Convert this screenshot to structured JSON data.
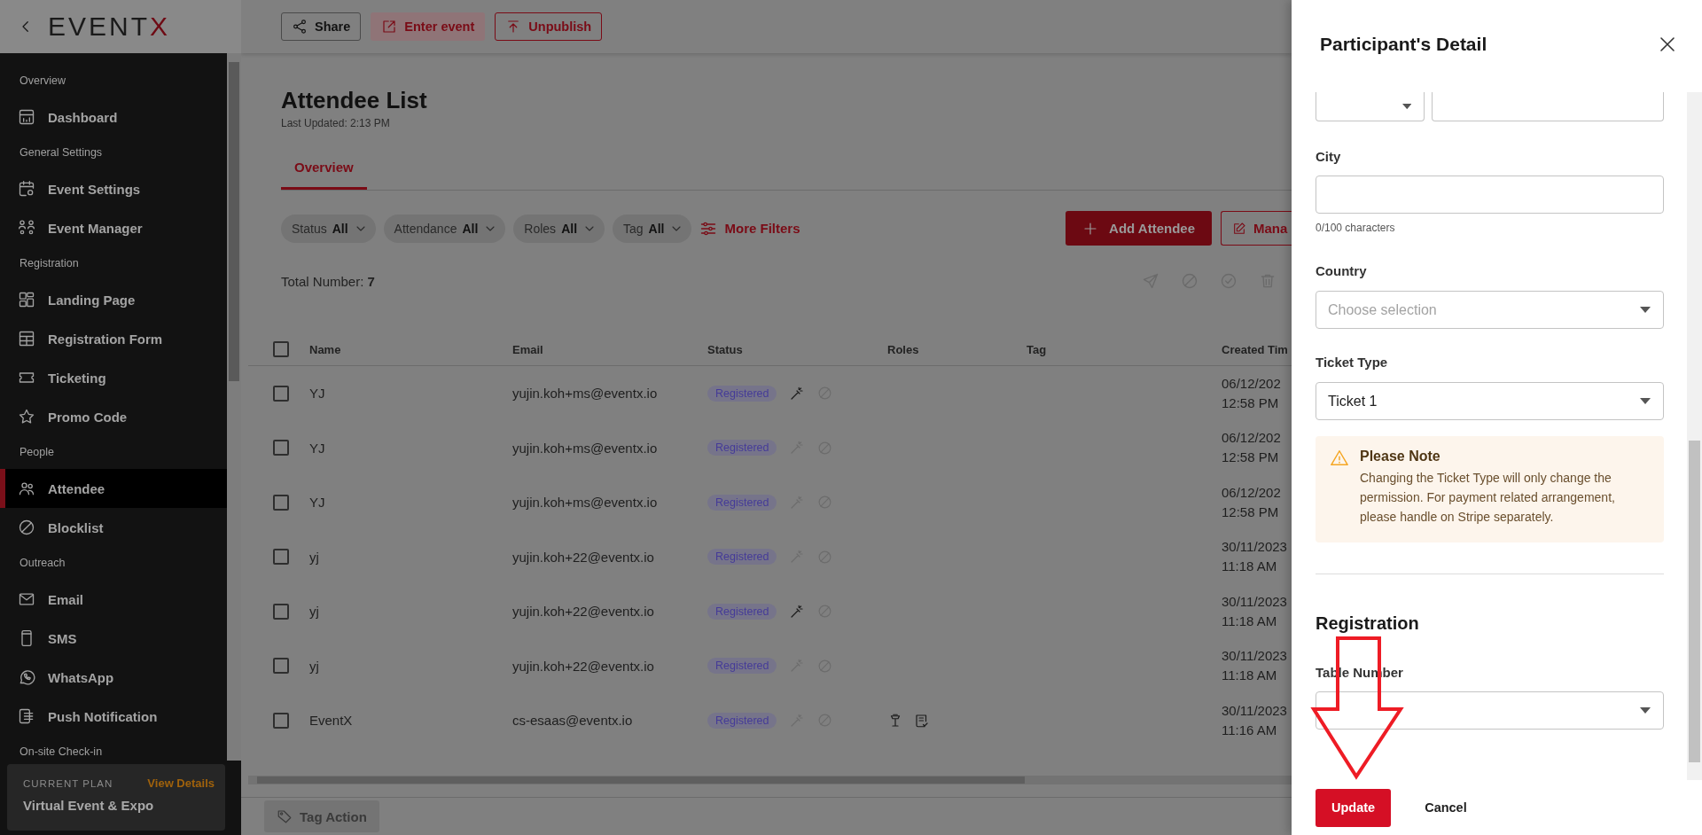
{
  "header": {
    "logo": "EVENT",
    "logo_accent": "X"
  },
  "sidebar": {
    "sections": [
      {
        "label": "Overview",
        "items": [
          {
            "label": "Dashboard",
            "selected": false
          }
        ]
      },
      {
        "label": "General Settings",
        "items": [
          {
            "label": "Event Settings",
            "selected": false
          },
          {
            "label": "Event Manager",
            "selected": false
          }
        ]
      },
      {
        "label": "Registration",
        "items": [
          {
            "label": "Landing Page",
            "selected": false
          },
          {
            "label": "Registration Form",
            "selected": false
          },
          {
            "label": "Ticketing",
            "selected": false
          },
          {
            "label": "Promo Code",
            "selected": false
          }
        ]
      },
      {
        "label": "People",
        "items": [
          {
            "label": "Attendee",
            "selected": true
          },
          {
            "label": "Blocklist",
            "selected": false
          }
        ]
      },
      {
        "label": "Outreach",
        "items": [
          {
            "label": "Email",
            "selected": false
          },
          {
            "label": "SMS",
            "selected": false
          },
          {
            "label": "WhatsApp",
            "selected": false
          },
          {
            "label": "Push Notification",
            "selected": false
          }
        ]
      },
      {
        "label": "On-site Check-in"
      }
    ],
    "plan": {
      "caption": "CURRENT PLAN",
      "link": "View Details",
      "name": "Virtual Event & Expo"
    }
  },
  "toolbar": {
    "buttons": [
      {
        "label": "Share",
        "kind": "neutral"
      },
      {
        "label": "Enter event",
        "kind": "tinted"
      },
      {
        "label": "Unpublish",
        "kind": "outline"
      }
    ]
  },
  "page": {
    "title": "Attendee List",
    "updated": "Last Updated: 2:13 PM"
  },
  "tabs": [
    {
      "label": "Overview",
      "selected": true
    }
  ],
  "filters": [
    {
      "label": "Status",
      "value": "All"
    },
    {
      "label": "Attendance",
      "value": "All"
    },
    {
      "label": "Roles",
      "value": "All"
    },
    {
      "label": "Tag",
      "value": "All"
    }
  ],
  "more_filters": "More Filters",
  "actions": [
    {
      "label": "Add Attendee",
      "kind": "primary"
    },
    {
      "label": "Mana",
      "kind": "outline"
    }
  ],
  "total": "Total Number: **7**",
  "table": {
    "all_selected": false,
    "columns": [
      "Name",
      "Email",
      "Status",
      "Roles",
      "Tag",
      "Created Tim"
    ],
    "rows": [
      {
        "selected": false,
        "name": "YJ",
        "email": "yujin.koh+ms@eventx.io",
        "status": "Registered",
        "check_in_active": true,
        "date": "06/12/202",
        "time": "12:58 PM"
      },
      {
        "selected": false,
        "name": "YJ",
        "email": "yujin.koh+ms@eventx.io",
        "status": "Registered",
        "check_in_active": false,
        "date": "06/12/202",
        "time": "12:58 PM"
      },
      {
        "selected": false,
        "name": "YJ",
        "email": "yujin.koh+ms@eventx.io",
        "status": "Registered",
        "check_in_active": false,
        "date": "06/12/202",
        "time": "12:58 PM"
      },
      {
        "selected": false,
        "name": "yj",
        "email": "yujin.koh+22@eventx.io",
        "status": "Registered",
        "check_in_active": false,
        "date": "30/11/2023",
        "time": "11:18 AM"
      },
      {
        "selected": false,
        "name": "yj",
        "email": "yujin.koh+22@eventx.io",
        "status": "Registered",
        "check_in_active": true,
        "date": "30/11/2023",
        "time": "11:18 AM"
      },
      {
        "selected": false,
        "name": "yj",
        "email": "yujin.koh+22@eventx.io",
        "status": "Registered",
        "check_in_active": false,
        "date": "30/11/2023",
        "time": "11:18 AM"
      },
      {
        "selected": false,
        "name": "EventX",
        "email": "cs-esaas@eventx.io",
        "status": "Registered",
        "check_in_active": false,
        "roles": [
          {
            "kind": "lectern"
          },
          {
            "kind": "form"
          }
        ],
        "date": "30/11/2023",
        "time": "11:16 AM"
      }
    ]
  },
  "tag_action": {
    "label": "Tag Action",
    "disabled": true
  },
  "drawer": {
    "title": "Participant's Detail",
    "fields": [
      {
        "kind": "pair"
      },
      {
        "kind": "text",
        "label": "City",
        "helper": "0/100 characters"
      },
      {
        "kind": "select",
        "label": "Country",
        "placeholder": "Choose selection"
      },
      {
        "kind": "select",
        "label": "Ticket Type",
        "value": "Ticket 1"
      },
      {
        "kind": "note",
        "title": "Please Note",
        "text": "Changing the Ticket Type will only change the permission. For payment related arrangement, please handle on Stripe separately."
      },
      {
        "kind": "divider"
      },
      {
        "kind": "heading",
        "text": "Registration"
      },
      {
        "kind": "select",
        "label": "Table Number"
      }
    ],
    "footer": [
      {
        "label": "Update",
        "kind": "primary"
      },
      {
        "label": "Cancel",
        "kind": "plain"
      }
    ]
  }
}
